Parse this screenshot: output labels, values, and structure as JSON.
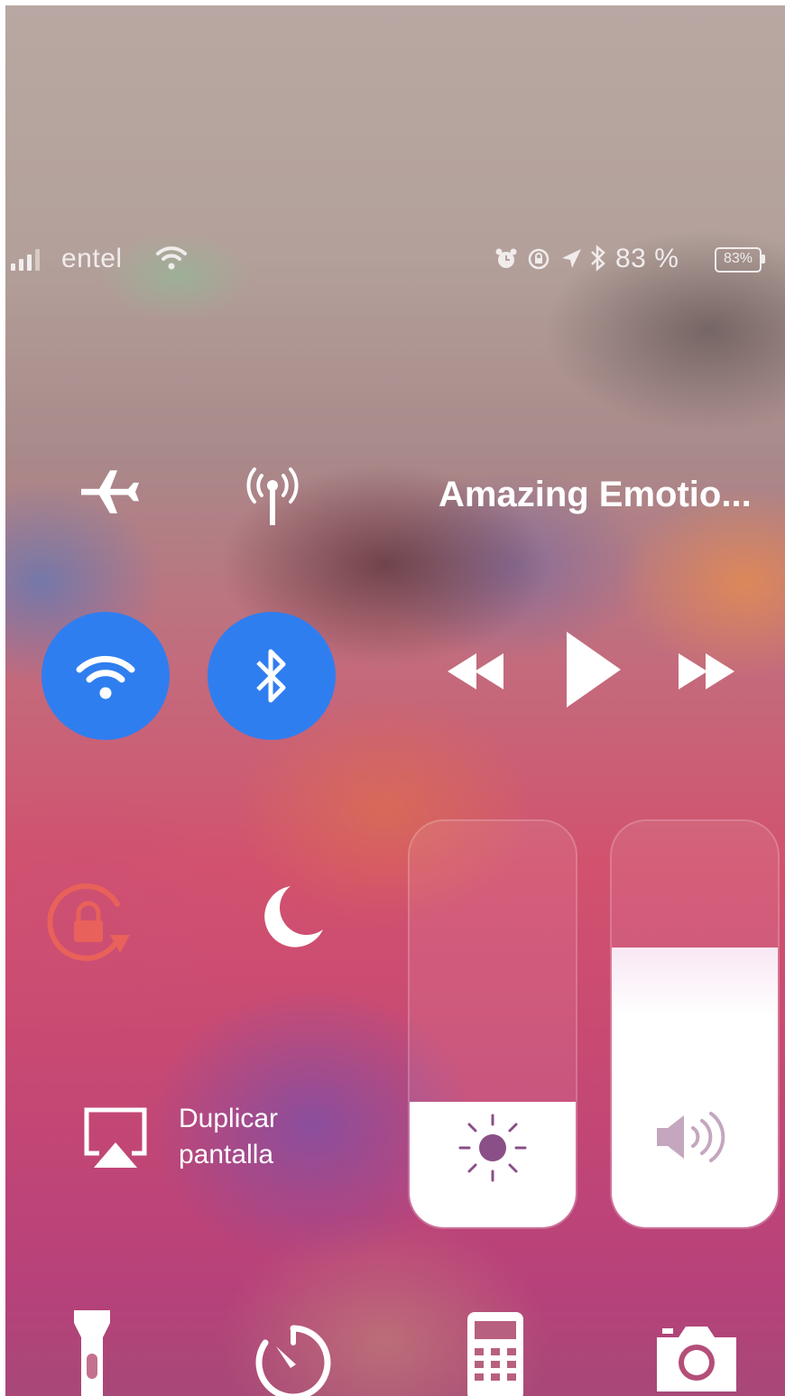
{
  "status_bar": {
    "carrier": "entel",
    "battery_percent_text": "83 %",
    "battery_icon_text": "83%",
    "icons": [
      "signal-icon",
      "wifi-icon",
      "alarm-icon",
      "orientation-lock-icon",
      "location-icon",
      "bluetooth-icon",
      "battery-icon"
    ]
  },
  "connectivity": {
    "airplane_mode": false,
    "cellular_data": false,
    "wifi": true,
    "bluetooth": true,
    "active_color": "#2f7ef0"
  },
  "now_playing": {
    "title": "Amazing Emotio..."
  },
  "toggles": {
    "orientation_lock": true,
    "orientation_lock_color": "#e8615a",
    "do_not_disturb": false
  },
  "screen_mirroring": {
    "label_line1": "Duplicar",
    "label_line2": "pantalla"
  },
  "brightness": {
    "level_percent": 31
  },
  "volume": {
    "level_percent": 69
  },
  "bottom_shortcuts": [
    "flashlight-icon",
    "timer-icon",
    "calculator-icon",
    "camera-icon"
  ]
}
